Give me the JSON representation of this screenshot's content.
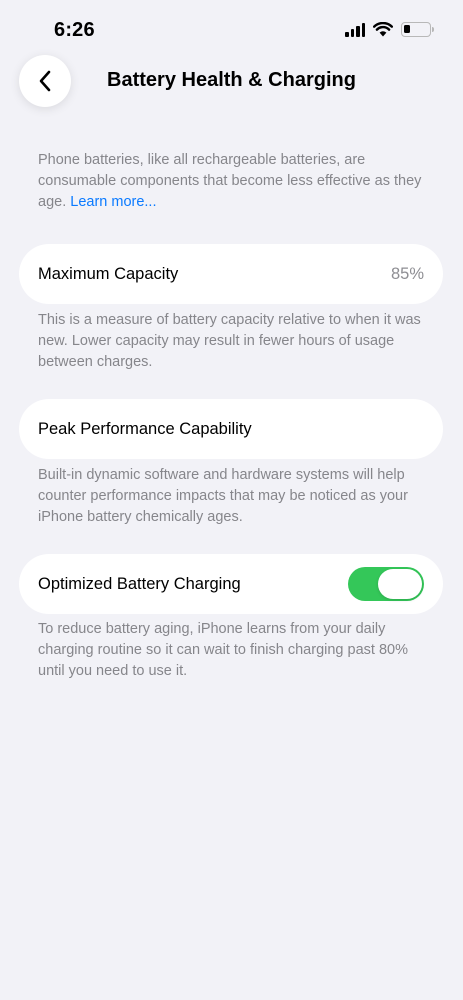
{
  "status_bar": {
    "time": "6:26",
    "battery_level": 0.25
  },
  "nav": {
    "back_icon": "chevron-left-icon",
    "title": "Battery Health & Charging"
  },
  "intro": {
    "text": "Phone batteries, like all rechargeable batteries, are consumable components that become less effective as they age. ",
    "link": "Learn more..."
  },
  "maximum_capacity": {
    "label": "Maximum Capacity",
    "value": "85%",
    "footer": "This is a measure of battery capacity relative to when it was new. Lower capacity may result in fewer hours of usage between charges."
  },
  "peak_performance": {
    "label": "Peak Performance Capability",
    "footer": "Built-in dynamic software and hardware systems will help counter performance impacts that may be noticed as your iPhone battery chemically ages."
  },
  "optimized_charging": {
    "label": "Optimized Battery Charging",
    "enabled": true,
    "footer": "To reduce battery aging, iPhone learns from your daily charging routine so it can wait to finish charging past 80% until you need to use it."
  },
  "colors": {
    "background": "#f2f2f7",
    "link": "#0a7aff",
    "toggle_on": "#34c759",
    "secondary_text": "#86868b"
  }
}
